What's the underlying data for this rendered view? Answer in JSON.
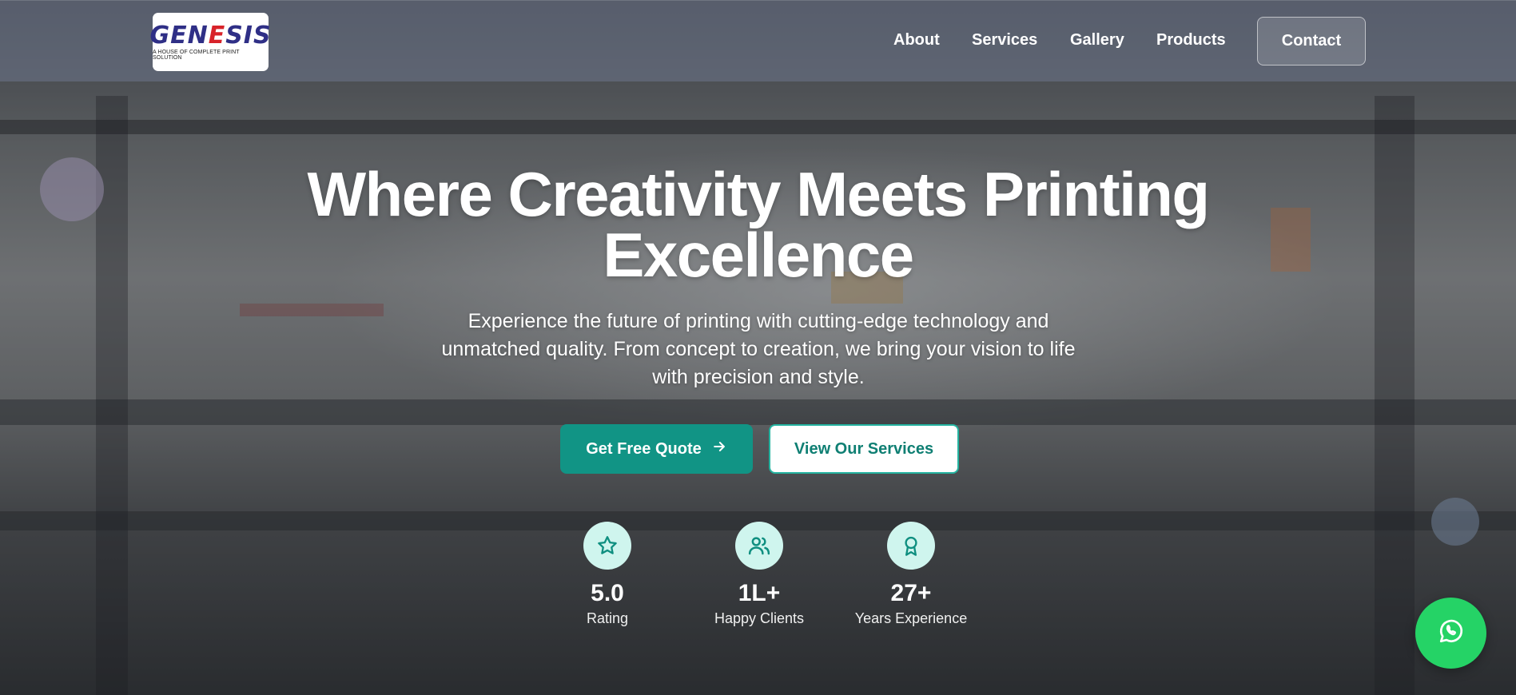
{
  "brand": {
    "logo_text_left": "GEN",
    "logo_text_mid": "E",
    "logo_text_right": "SIS",
    "logo_tagline": "A HOUSE OF COMPLETE PRINT SOLUTION"
  },
  "nav": {
    "items": [
      {
        "label": "About"
      },
      {
        "label": "Services"
      },
      {
        "label": "Gallery"
      },
      {
        "label": "Products"
      }
    ],
    "contact_label": "Contact"
  },
  "hero": {
    "title_line1": "Where Creativity Meets Printing",
    "title_line2": "Excellence",
    "subtitle": "Experience the future of printing with cutting-edge technology and unmatched quality. From concept to creation, we bring your vision to life with precision and style.",
    "primary_cta": "Get Free Quote",
    "secondary_cta": "View Our Services"
  },
  "stats": [
    {
      "value": "5.0",
      "label": "Rating",
      "icon": "star-icon"
    },
    {
      "value": "1L+",
      "label": "Happy Clients",
      "icon": "users-icon"
    },
    {
      "value": "27+",
      "label": "Years Experience",
      "icon": "award-icon"
    }
  ],
  "colors": {
    "accent": "#119485",
    "accent_light": "#cff5ee",
    "whatsapp": "#25d366",
    "logo_blue": "#2f2f86",
    "logo_red": "#d8232a"
  }
}
